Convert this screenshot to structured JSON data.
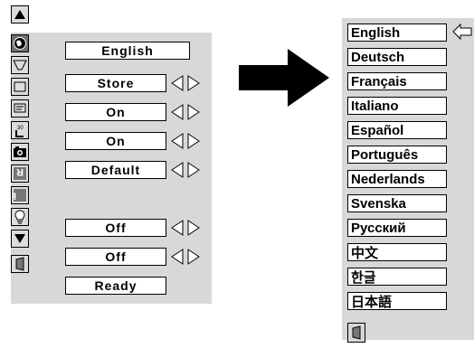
{
  "left_menu": {
    "items": [
      {
        "icon": "language-globe-icon",
        "value": "English",
        "has_adjust": false,
        "selected": true
      },
      {
        "icon": "keystone-icon",
        "value": "Store",
        "has_adjust": true
      },
      {
        "icon": "blue-background-icon",
        "value": "On",
        "has_adjust": true
      },
      {
        "icon": "display-icon",
        "value": "On",
        "has_adjust": true
      },
      {
        "icon": "logo-icon",
        "value": "Default",
        "has_adjust": true
      },
      {
        "icon": "camera-icon",
        "value": "",
        "has_adjust": false
      },
      {
        "icon": "ceiling-icon",
        "value": "Off",
        "has_adjust": true
      },
      {
        "icon": "rear-icon",
        "value": "Off",
        "has_adjust": true
      },
      {
        "icon": "lamp-icon",
        "value": "Ready",
        "has_adjust": false
      }
    ],
    "logo_icon_number": "30"
  },
  "language_menu": {
    "items": [
      "English",
      "Deutsch",
      "Français",
      "Italiano",
      "Español",
      "Português",
      "Nederlands",
      "Svenska",
      "Русский",
      "中文",
      "한글",
      "日本語"
    ],
    "selected_index": 0
  },
  "colors": {
    "panel_gray": "#d8d8d8",
    "selected_icon_bg": "#6f6f6f",
    "box_bg": "#ffffff",
    "text": "#000000"
  }
}
